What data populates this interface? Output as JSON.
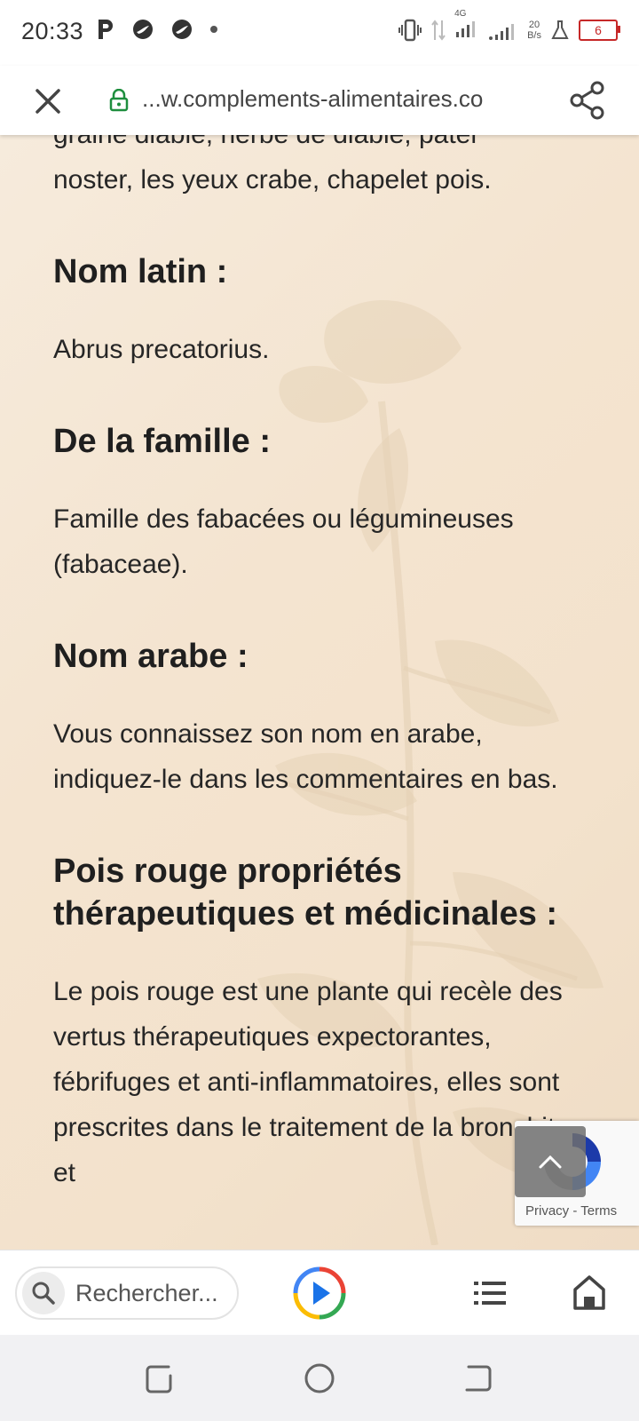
{
  "status_bar": {
    "time": "20:33",
    "network_label": "4G",
    "speed_value": "20",
    "speed_unit": "B/s",
    "battery": "6",
    "icons": [
      "p-icon",
      "bird-icon",
      "bird-icon",
      "dot-icon",
      "vibrate-icon",
      "data-arrows-icon",
      "signal-icon",
      "signal-icon",
      "flask-icon",
      "battery-icon"
    ]
  },
  "browser": {
    "url": "...w.complements-alimentaires.co",
    "search_placeholder": "Rechercher...",
    "accent": "#1a73e8"
  },
  "article": {
    "partial_top": "graine diable, herbe de diable, pater",
    "p0": "noster, les yeux crabe, chapelet pois.",
    "h_latin": "Nom latin :",
    "p_latin": "Abrus precatorius.",
    "h_famille": "De la famille :",
    "p_famille": "Famille des fabacées ou légumineuses (fabaceae).",
    "h_arabe": "Nom arabe :",
    "p_arabe": "Vous connaissez son nom en arabe, indiquez-le dans les commentaires en bas.",
    "h_proprietes": "Pois rouge propriétés thérapeutiques et médicinales :",
    "p_proprietes": "Le pois rouge est une plante qui recèle des vertus thérapeutiques expectorantes, fébrifuges et anti-inflammatoires, elles sont prescrites dans le traitement de la bronchite et"
  },
  "recaptcha": {
    "privacy": "Privacy",
    "separator": " - ",
    "terms": "Terms"
  },
  "colors": {
    "page_bg": "#f5e8d6",
    "battery_low": "#c62828"
  }
}
